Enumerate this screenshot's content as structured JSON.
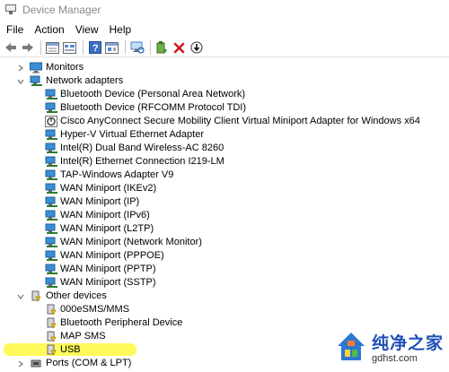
{
  "window": {
    "title": "Device Manager"
  },
  "menu": [
    "File",
    "Action",
    "View",
    "Help"
  ],
  "toolbar": [
    {
      "name": "back-icon"
    },
    {
      "name": "forward-icon"
    },
    {
      "sep": true
    },
    {
      "name": "properties-icon"
    },
    {
      "name": "details-icon"
    },
    {
      "sep": true
    },
    {
      "name": "help-icon"
    },
    {
      "name": "view-icon"
    },
    {
      "sep": true
    },
    {
      "name": "scan-hardware-icon"
    },
    {
      "sep": true
    },
    {
      "name": "update-driver-icon"
    },
    {
      "name": "uninstall-icon"
    },
    {
      "name": "download-icon"
    }
  ],
  "tree": {
    "monitors": "Monitors",
    "network_adapters": "Network adapters",
    "network_items": [
      "Bluetooth Device (Personal Area Network)",
      "Bluetooth Device (RFCOMM Protocol TDI)",
      "Cisco AnyConnect Secure Mobility Client Virtual Miniport Adapter for Windows x64",
      "Hyper-V Virtual Ethernet Adapter",
      "Intel(R) Dual Band Wireless-AC 8260",
      "Intel(R) Ethernet Connection I219-LM",
      "TAP-Windows Adapter V9",
      "WAN Miniport (IKEv2)",
      "WAN Miniport (IP)",
      "WAN Miniport (IPv6)",
      "WAN Miniport (L2TP)",
      "WAN Miniport (Network Monitor)",
      "WAN Miniport (PPPOE)",
      "WAN Miniport (PPTP)",
      "WAN Miniport (SSTP)"
    ],
    "other_devices": "Other devices",
    "other_items": [
      "000eSMS/MMS",
      "Bluetooth Peripheral Device",
      "MAP SMS",
      "USB"
    ],
    "ports": "Ports (COM & LPT)"
  },
  "watermark": {
    "title": "纯净之家",
    "url": "gdhst.com"
  },
  "colors": {
    "highlight": "#fff84a",
    "watermark_blue": "#1f4fb8",
    "warning_yellow": "#f5c400"
  }
}
